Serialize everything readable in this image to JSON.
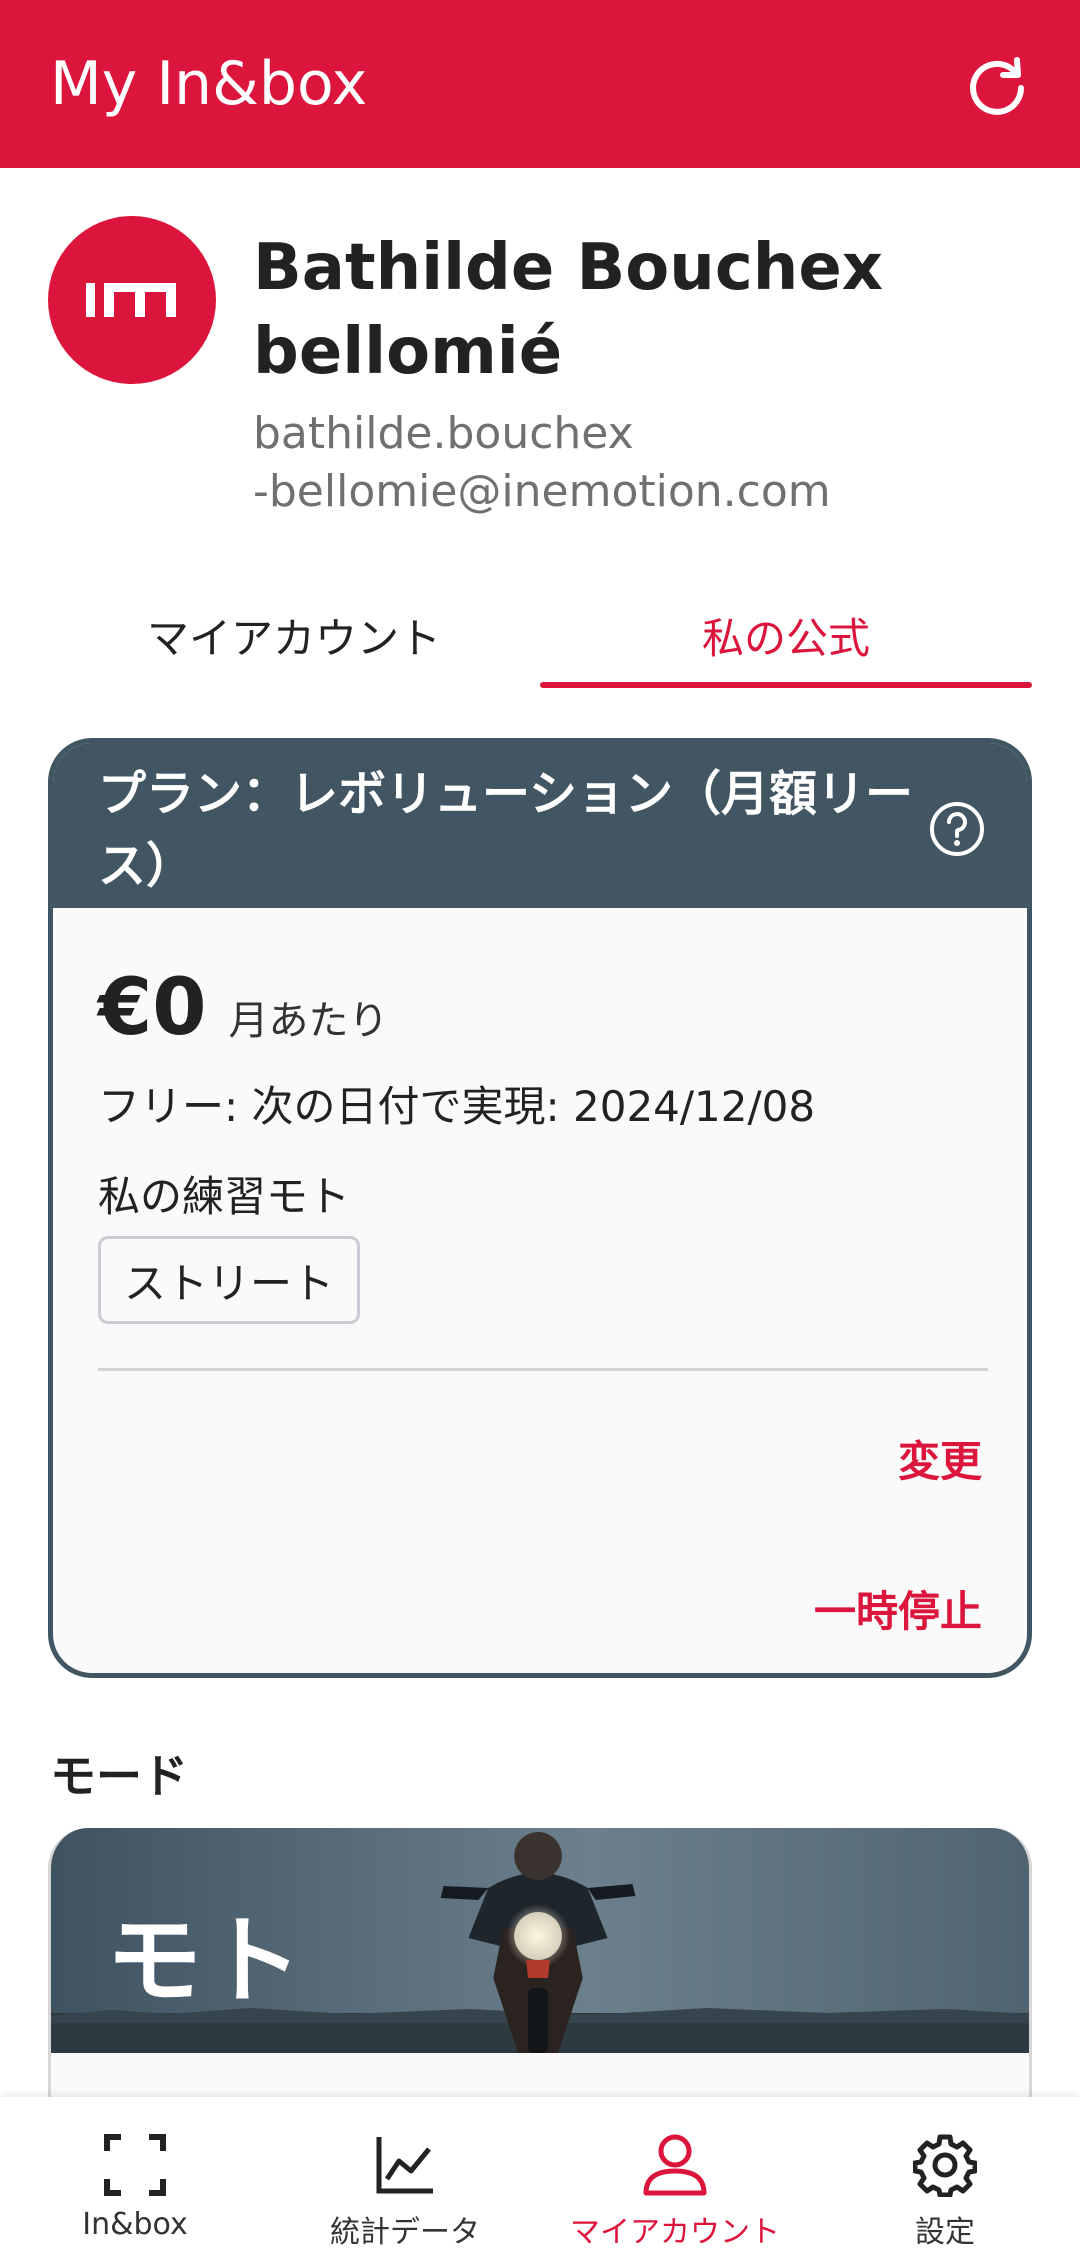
{
  "appbar": {
    "title": "My In&box",
    "refresh_icon": "refresh-icon",
    "color": "#dc153d"
  },
  "profile": {
    "avatar_logo": "inemotion-logo",
    "name_line1": "Bathilde Bouchex",
    "name_line2": "bellomié",
    "email_line1": "bathilde.bouchex",
    "email_line2": "-bellomie@inemotion.com"
  },
  "tabs": [
    {
      "label": "マイアカウント",
      "active": false
    },
    {
      "label": "私の公式",
      "active": true
    }
  ],
  "plan": {
    "title": "プラン：レボリューション（月額リース）",
    "price": "€0",
    "per_month": "月あたり",
    "free_until": "フリー: 次の日付で実現: 2024/12/08",
    "practice_label": "私の練習モト",
    "practice_chip": "ストリート",
    "change_label": "変更",
    "pause_label": "一時停止",
    "header_color": "#415562"
  },
  "mode": {
    "heading": "モード",
    "card_label": "モト"
  },
  "bottom_nav": [
    {
      "label": "In&box",
      "icon": "scan-frame-icon",
      "active": false
    },
    {
      "label": "統計データ",
      "icon": "line-chart-icon",
      "active": false
    },
    {
      "label": "マイアカウント",
      "icon": "user-icon",
      "active": true
    },
    {
      "label": "設定",
      "icon": "gear-icon",
      "active": false
    }
  ]
}
